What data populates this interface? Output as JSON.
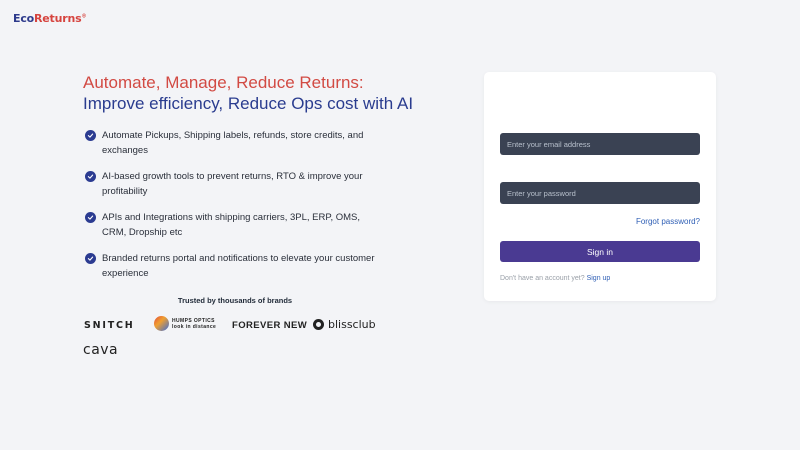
{
  "logo": {
    "part1": "Eco",
    "part2": "Returns",
    "mark": "®"
  },
  "hero": {
    "headline1": "Automate, Manage, Reduce Returns:",
    "headline2": "Improve efficiency, Reduce Ops cost with AI"
  },
  "features": [
    {
      "icon": "check-circle-icon",
      "text": "Automate Pickups, Shipping labels, refunds, store credits, and exchanges"
    },
    {
      "icon": "check-circle-icon",
      "text": "AI-based growth tools to prevent returns, RTO & improve your profitability"
    },
    {
      "icon": "check-circle-icon",
      "text": "APIs and Integrations with shipping carriers, 3PL, ERP, OMS, CRM, Dropship etc"
    },
    {
      "icon": "check-circle-icon",
      "text": "Branded returns portal and notifications to elevate your customer experience"
    }
  ],
  "brands": {
    "heading": "Trusted by thousands of brands",
    "snitch": "SNITCH",
    "humps_line1": "HUMPS OPTICS",
    "humps_line2": "look in distance",
    "forever_new": "FOREVER NEW",
    "blissclub": "blissclub",
    "cava": "cava"
  },
  "login": {
    "email_placeholder": "Enter your email address",
    "password_placeholder": "Enter your password",
    "forgot_label": "Forgot password?",
    "signin_label": "Sign in",
    "no_account": "Don't have an account yet?",
    "signup_label": "Sign up"
  },
  "colors": {
    "brand_red": "#d24a43",
    "brand_blue": "#2a3c8f",
    "button": "#4a3a92",
    "input_bg": "#3a4253",
    "link": "#2f5fb5"
  }
}
